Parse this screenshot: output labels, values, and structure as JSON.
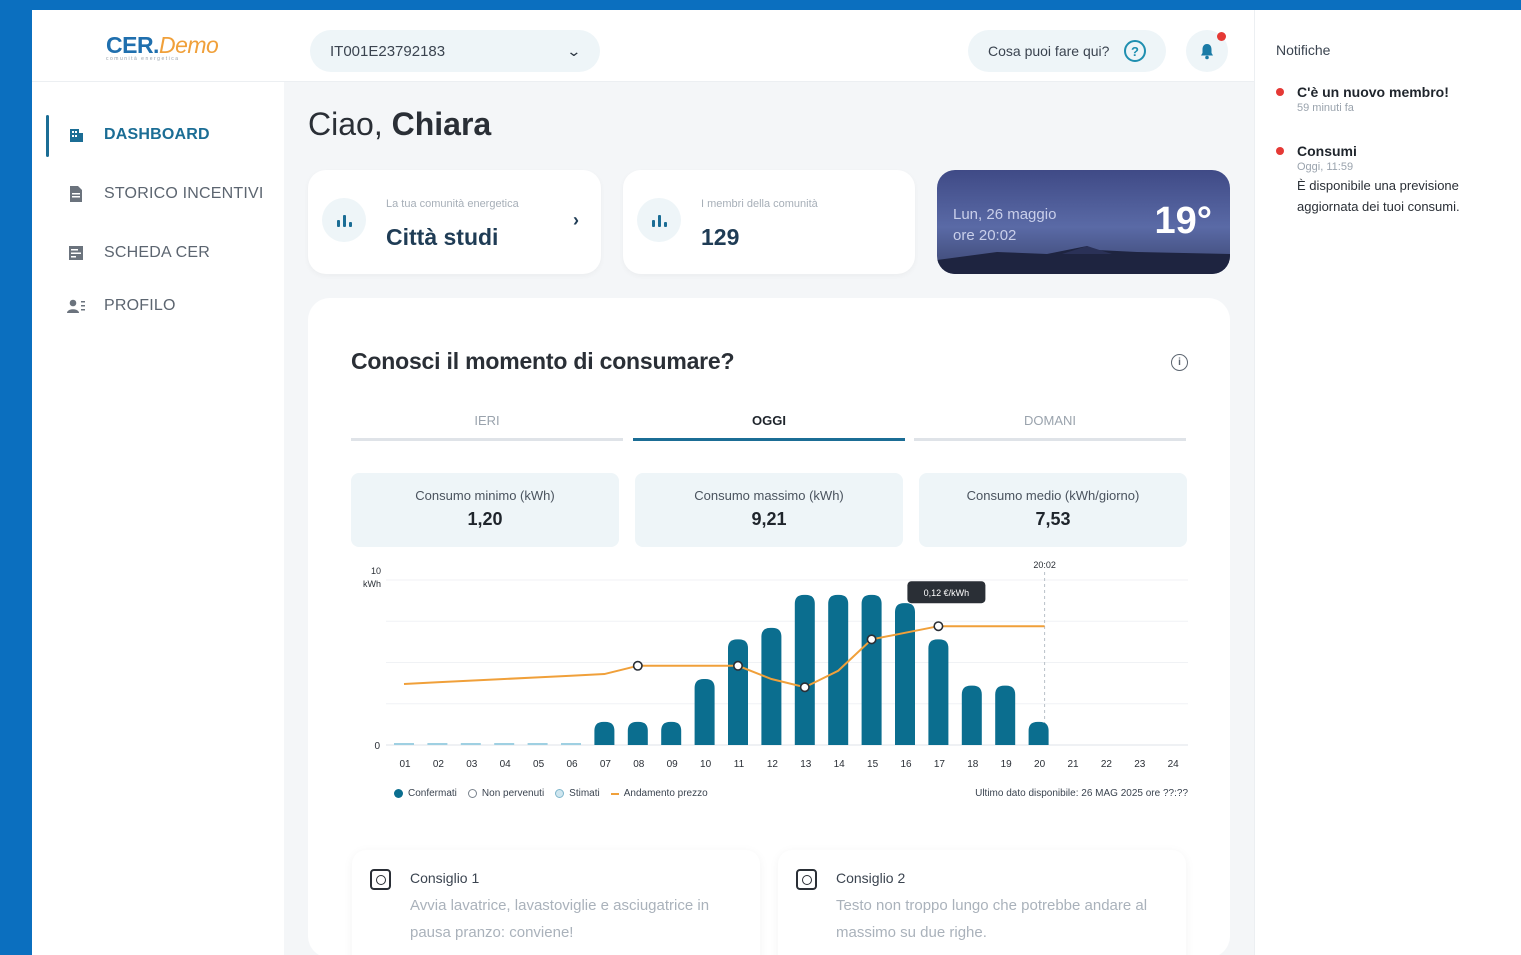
{
  "header": {
    "logo_main": "CER.",
    "logo_accent": "Demo",
    "logo_sub": "comunità energetica",
    "pod_selector_value": "IT001E23792183",
    "help_label": "Cosa puoi fare qui?"
  },
  "sidebar": {
    "items": [
      {
        "label": "DASHBOARD",
        "icon": "building-icon",
        "active": true
      },
      {
        "label": "STORICO INCENTIVI",
        "icon": "document-icon",
        "active": false
      },
      {
        "label": "SCHEDA CER",
        "icon": "card-icon",
        "active": false
      },
      {
        "label": "PROFILO",
        "icon": "users-icon",
        "active": false
      }
    ]
  },
  "greeting": {
    "prefix": "Ciao, ",
    "name": "Chiara"
  },
  "stats": {
    "community": {
      "label": "La tua comunità energetica",
      "value": "Città studi"
    },
    "members": {
      "label": "I membri della comunità",
      "value": "129"
    }
  },
  "weather": {
    "date_line1": "Lun, 26 maggio",
    "date_line2": "ore 20:02",
    "temperature": "19°"
  },
  "consumption": {
    "title": "Conosci il momento di consumare?",
    "tabs": [
      {
        "label": "IERI",
        "active": false
      },
      {
        "label": "OGGI",
        "active": true
      },
      {
        "label": "DOMANI",
        "active": false
      }
    ],
    "kpis": [
      {
        "label": "Consumo minimo (kWh)",
        "value": "1,20"
      },
      {
        "label": "Consumo massimo (kWh)",
        "value": "9,21"
      },
      {
        "label": "Consumo medio (kWh/giorno)",
        "value": "7,53"
      }
    ],
    "legend": [
      {
        "label": "Confermati",
        "color": "#0b6e8f"
      },
      {
        "label": "Non pervenuti",
        "color": "#ffffff"
      },
      {
        "label": "Stimati",
        "color": "#cfe6ef"
      },
      {
        "label": "Andamento prezzo",
        "color": "#f0a03a"
      }
    ],
    "last_data": "Ultimo dato disponibile: 26 MAG 2025 ore ??:??",
    "tips": [
      {
        "title": "Consiglio 1",
        "body": "Avvia lavatrice, lavastoviglie e asciugatrice in pausa pranzo: conviene!"
      },
      {
        "title": "Consiglio 2",
        "body": "Testo non troppo lungo che potrebbe andare al massimo su due righe."
      }
    ]
  },
  "chart_data": {
    "type": "bar",
    "categories": [
      "01",
      "02",
      "03",
      "04",
      "05",
      "06",
      "07",
      "08",
      "09",
      "10",
      "11",
      "12",
      "13",
      "14",
      "15",
      "16",
      "17",
      "18",
      "19",
      "20",
      "21",
      "22",
      "23",
      "24"
    ],
    "series": [
      {
        "name": "Confermati",
        "values": [
          0,
          0,
          0,
          0,
          0,
          0,
          1.4,
          1.4,
          1.4,
          4.0,
          6.4,
          7.1,
          9.1,
          9.1,
          9.1,
          8.6,
          6.4,
          3.6,
          3.6,
          1.4,
          null,
          null,
          null,
          null
        ]
      },
      {
        "name": "Andamento prezzo",
        "values": [
          3.7,
          3.8,
          3.9,
          4.0,
          4.1,
          4.2,
          4.3,
          4.8,
          4.8,
          4.8,
          4.8,
          4.0,
          3.5,
          4.5,
          6.4,
          6.8,
          7.2,
          7.2,
          7.2,
          7.2,
          null,
          null,
          null,
          null
        ]
      }
    ],
    "ylim": [
      0,
      10
    ],
    "y_tick_labels": [
      "0",
      "10"
    ],
    "ylabel": "kWh",
    "marker_label": "20:02",
    "tooltip": "0,12 €/kWh",
    "tooltip_index": 16
  },
  "notifications": {
    "title": "Notifiche",
    "items": [
      {
        "title": "C'è un nuovo membro!",
        "time": "59 minuti fa",
        "message": ""
      },
      {
        "title": "Consumi",
        "time": "Oggi, 11:59",
        "message": "È disponibile una previsione aggiornata dei tuoi consumi."
      }
    ]
  }
}
